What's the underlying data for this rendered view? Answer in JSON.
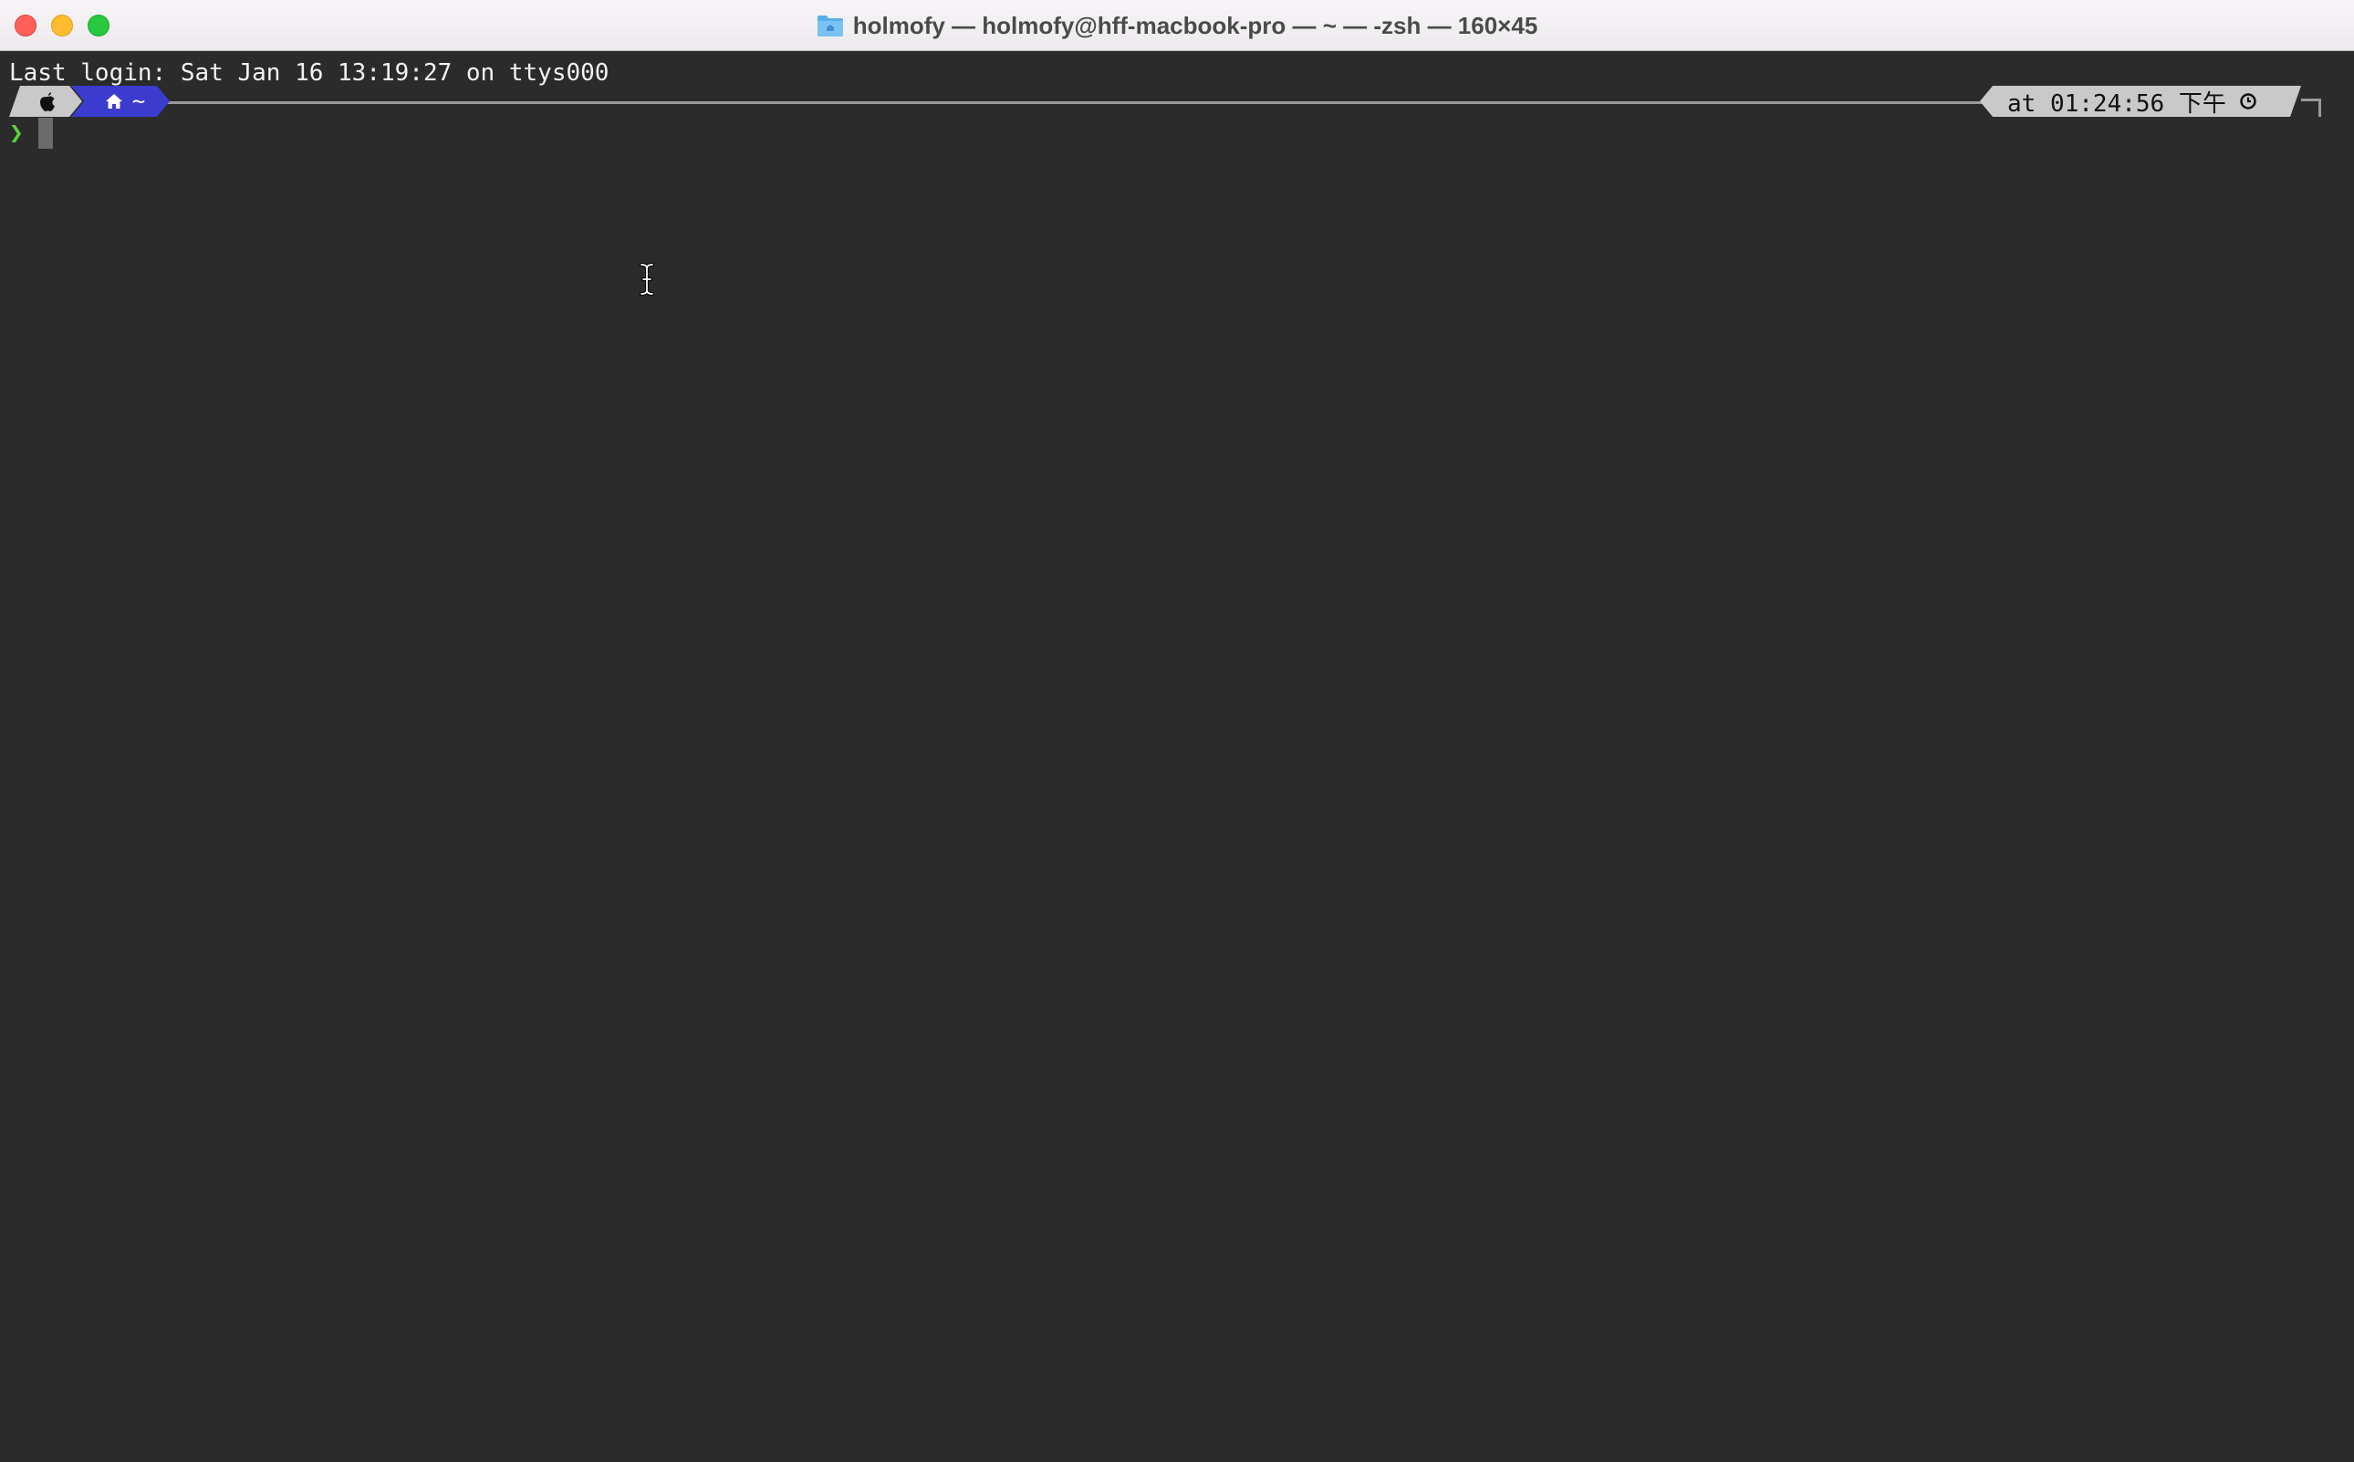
{
  "window": {
    "title": "holmofy — holmofy@hff-macbook-pro — ~ — -zsh — 160×45"
  },
  "terminal": {
    "last_login": "Last login: Sat Jan 16 13:19:27 on ttys000",
    "prompt": {
      "home_dir": "~",
      "time_text": "at 01:24:56 下午",
      "chevron": "❯",
      "icons": [
        "apple-icon",
        "home-icon",
        "clock-icon"
      ]
    }
  },
  "colors": {
    "background": "#2b2b2b",
    "home_segment": "#3b3bcf",
    "os_segment": "#c9c9c9",
    "prompt_chevron": "#5ad33a"
  }
}
